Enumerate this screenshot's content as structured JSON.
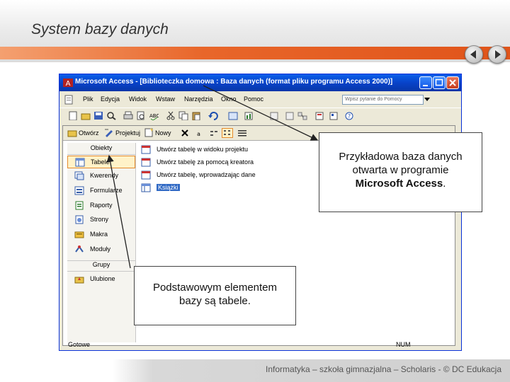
{
  "slide": {
    "title": "System bazy danych",
    "footer": "Informatyka – szkoła gimnazjalna – Scholaris - © DC Edukacja"
  },
  "window": {
    "title": "Microsoft Access - [Biblioteczka domowa : Baza danych (format pliku programu Access 2000)]",
    "menu": [
      "Plik",
      "Edycja",
      "Widok",
      "Wstaw",
      "Narzędzia",
      "Okno",
      "Pomoc"
    ],
    "help_placeholder": "Wpisz pytanie do Pomocy",
    "db_toolbar": {
      "open": "Otwórz",
      "design": "Projektuj",
      "new": "Nowy"
    },
    "sidebar": {
      "objects_header": "Obiekty",
      "items": [
        "Tabele",
        "Kwerendy",
        "Formularze",
        "Raporty",
        "Strony",
        "Makra",
        "Moduły"
      ],
      "groups_header": "Grupy",
      "groups": [
        "Ulubione"
      ]
    },
    "objects": [
      "Utwórz tabelę w widoku projektu",
      "Utwórz tabelę za pomocą kreatora",
      "Utwórz tabelę, wprowadzając dane",
      "Książki"
    ],
    "status": "Gotowe",
    "status_num": "NUM"
  },
  "callouts": {
    "top_lines": [
      "Przykładowa baza danych",
      "otwarta w programie"
    ],
    "top_bold": "Microsoft Access",
    "top_end": ".",
    "bottom": "Podstawowym elementem bazy są tabele."
  }
}
